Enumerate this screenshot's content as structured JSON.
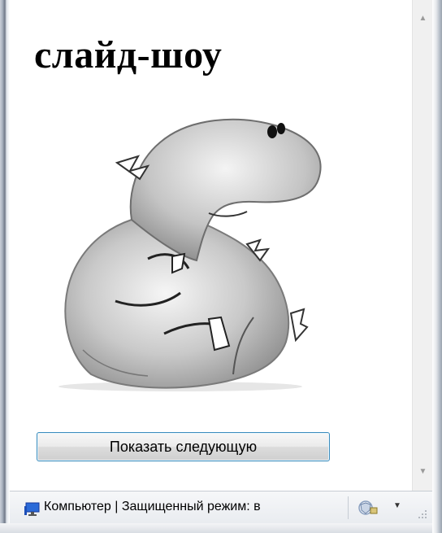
{
  "page": {
    "title": "слайд-шоу",
    "next_button_label": "Показать следующую"
  },
  "status_bar": {
    "text": "Компьютер | Защищенный режим: в"
  },
  "icons": {
    "status": "monitor-icon",
    "security": "security-shield-icon",
    "dropdown": "chevron-down-icon",
    "scroll_up": "scroll-up-arrow-icon",
    "scroll_down": "scroll-down-arrow-icon"
  },
  "colors": {
    "button_border": "#3c8dbd",
    "page_background": "#ffffff"
  }
}
